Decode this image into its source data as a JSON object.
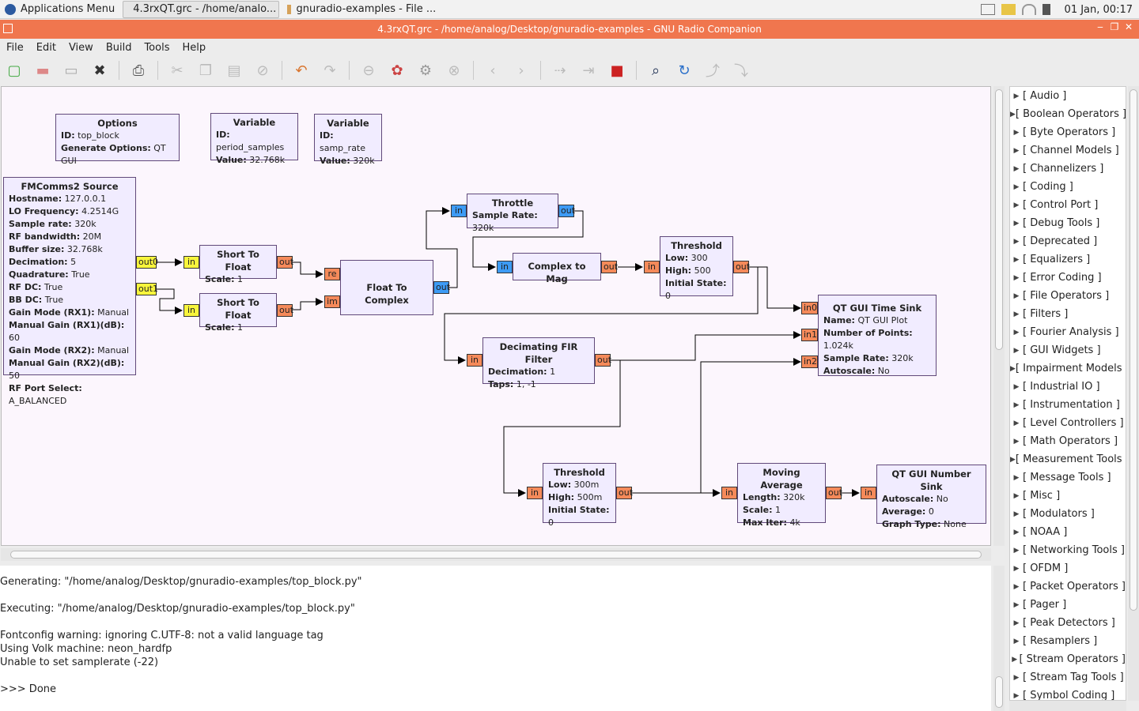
{
  "taskbar": {
    "apps_menu": "Applications Menu",
    "tasks": [
      "4.3rxQT.grc - /home/analo...",
      "gnuradio-examples - File ..."
    ],
    "clock": "01 Jan, 00:17"
  },
  "window": {
    "title": "4.3rxQT.grc - /home/analog/Desktop/gnuradio-examples - GNU Radio Companion"
  },
  "menu": [
    "File",
    "Edit",
    "View",
    "Build",
    "Tools",
    "Help"
  ],
  "toolbar": [
    "new-icon",
    "open-icon",
    "save-icon",
    "close-icon",
    "print-icon",
    "cut-icon",
    "copy-icon",
    "paste-icon",
    "delete-icon",
    "undo-icon",
    "redo-icon",
    "disable-icon",
    "errors-icon",
    "generate-icon",
    "stop-icon",
    "rotate-left-icon",
    "rotate-right-icon",
    "bypass-icon",
    "enable-icon",
    "kill-icon",
    "find-icon",
    "reload-icon",
    "move-up-icon",
    "move-down-icon"
  ],
  "blocks": {
    "options": {
      "title": "Options",
      "rows": [
        [
          "ID:",
          "top_block"
        ],
        [
          "Generate Options:",
          "QT GUI"
        ]
      ]
    },
    "var1": {
      "title": "Variable",
      "rows": [
        [
          "ID:",
          "period_samples"
        ],
        [
          "Value:",
          "32.768k"
        ]
      ]
    },
    "var2": {
      "title": "Variable",
      "rows": [
        [
          "ID:",
          "samp_rate"
        ],
        [
          "Value:",
          "320k"
        ]
      ]
    },
    "fmcomms": {
      "title": "FMComms2 Source",
      "rows": [
        [
          "Hostname:",
          "127.0.0.1"
        ],
        [
          "LO Frequency:",
          "4.2514G"
        ],
        [
          "Sample rate:",
          "320k"
        ],
        [
          "RF bandwidth:",
          "20M"
        ],
        [
          "Buffer size:",
          "32.768k"
        ],
        [
          "Decimation:",
          "5"
        ],
        [
          "Quadrature:",
          "True"
        ],
        [
          "RF DC:",
          "True"
        ],
        [
          "BB DC:",
          "True"
        ],
        [
          "Gain Mode (RX1):",
          "Manual"
        ],
        [
          "Manual Gain (RX1)(dB):",
          "60"
        ],
        [
          "Gain Mode (RX2):",
          "Manual"
        ],
        [
          "Manual Gain (RX2)(dB):",
          "50"
        ],
        [
          "RF Port Select:",
          "A_BALANCED"
        ]
      ]
    },
    "s2f1": {
      "title": "Short To Float",
      "rows": [
        [
          "Scale:",
          "1"
        ]
      ]
    },
    "s2f2": {
      "title": "Short To Float",
      "rows": [
        [
          "Scale:",
          "1"
        ]
      ]
    },
    "f2c": {
      "title": "Float To Complex",
      "rows": []
    },
    "throttle": {
      "title": "Throttle",
      "rows": [
        [
          "Sample Rate:",
          "320k"
        ]
      ]
    },
    "c2mag": {
      "title": "Complex to Mag",
      "rows": []
    },
    "thresh1": {
      "title": "Threshold",
      "rows": [
        [
          "Low:",
          "300"
        ],
        [
          "High:",
          "500"
        ],
        [
          "Initial State:",
          "0"
        ]
      ]
    },
    "qtsink": {
      "title": "QT GUI Time Sink",
      "rows": [
        [
          "Name:",
          "QT GUI Plot"
        ],
        [
          "Number of Points:",
          "1.024k"
        ],
        [
          "Sample Rate:",
          "320k"
        ],
        [
          "Autoscale:",
          "No"
        ]
      ]
    },
    "fir": {
      "title": "Decimating FIR Filter",
      "rows": [
        [
          "Decimation:",
          "1"
        ],
        [
          "Taps:",
          "1, -1"
        ]
      ]
    },
    "thresh2": {
      "title": "Threshold",
      "rows": [
        [
          "Low:",
          "300m"
        ],
        [
          "High:",
          "500m"
        ],
        [
          "Initial State:",
          "0"
        ]
      ]
    },
    "movavg": {
      "title": "Moving Average",
      "rows": [
        [
          "Length:",
          "320k"
        ],
        [
          "Scale:",
          "1"
        ],
        [
          "Max Iter:",
          "4k"
        ]
      ]
    },
    "numsink": {
      "title": "QT GUI Number Sink",
      "rows": [
        [
          "Autoscale:",
          "No"
        ],
        [
          "Average:",
          "0"
        ],
        [
          "Graph Type:",
          "None"
        ]
      ]
    }
  },
  "ports": {
    "out0": "out0",
    "out1": "out1",
    "in": "in",
    "out": "out",
    "re": "re",
    "im": "im",
    "in0": "in0",
    "in1": "in1",
    "in2": "in2"
  },
  "console": [
    "Generating: \"/home/analog/Desktop/gnuradio-examples/top_block.py\"",
    "",
    "Executing: \"/home/analog/Desktop/gnuradio-examples/top_block.py\"",
    "",
    "Fontconfig warning: ignoring C.UTF-8: not a valid language tag",
    "Using Volk machine: neon_hardfp",
    "Unable to set samplerate (-22)",
    "",
    ">>> Done"
  ],
  "library": [
    "[ Audio ]",
    "[ Boolean Operators ]",
    "[ Byte Operators ]",
    "[ Channel Models ]",
    "[ Channelizers ]",
    "[ Coding ]",
    "[ Control Port ]",
    "[ Debug Tools ]",
    "[ Deprecated ]",
    "[ Equalizers ]",
    "[ Error Coding ]",
    "[ File Operators ]",
    "[ Filters ]",
    "[ Fourier Analysis ]",
    "[ GUI Widgets ]",
    "[ Impairment Models ]",
    "[ Industrial IO ]",
    "[ Instrumentation ]",
    "[ Level Controllers ]",
    "[ Math Operators ]",
    "[ Measurement Tools ]",
    "[ Message Tools ]",
    "[ Misc ]",
    "[ Modulators ]",
    "[ NOAA ]",
    "[ Networking Tools ]",
    "[ OFDM ]",
    "[ Packet Operators ]",
    "[ Pager ]",
    "[ Peak Detectors ]",
    "[ Resamplers ]",
    "[ Stream Operators ]",
    "[ Stream Tag Tools ]",
    "[ Symbol Coding ]"
  ],
  "colors": {
    "titlebar": "#f0764e",
    "block_bg": "#f1ecff",
    "port_short": "#f8f53c",
    "port_float": "#f58a5a",
    "port_complex": "#3d9bf5",
    "canvas": "#fcf6fd"
  }
}
